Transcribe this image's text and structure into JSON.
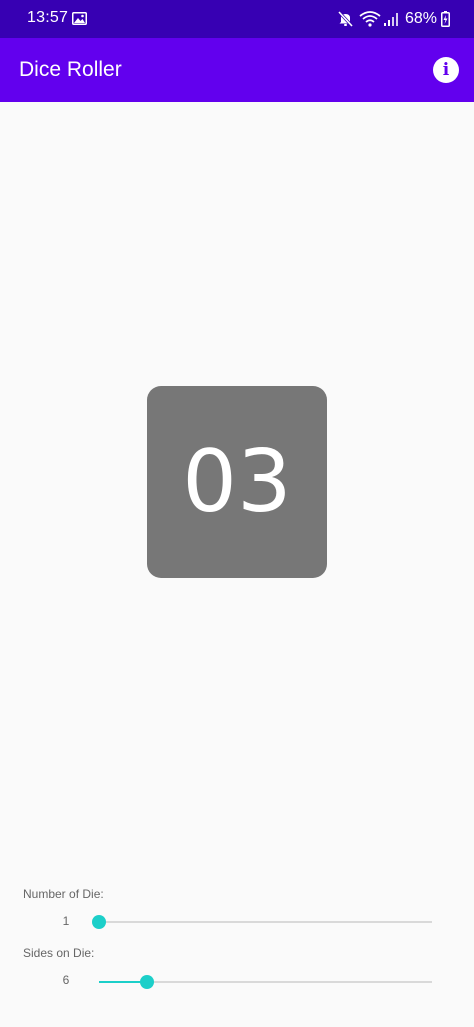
{
  "status_bar": {
    "time": "13:57",
    "battery": "68%",
    "icons": [
      "gallery-icon",
      "mute-icon",
      "wifi-icon",
      "signal-icon",
      "battery-icon"
    ]
  },
  "app_bar": {
    "title": "Dice Roller",
    "info_icon": "info-icon",
    "color": "#6200ee"
  },
  "die": {
    "value": "03",
    "color": "#777777"
  },
  "controls": {
    "number_of_die": {
      "label": "Number of Die:",
      "value": "1",
      "fraction": 0.0
    },
    "sides_on_die": {
      "label": "Sides on Die:",
      "value": "6",
      "fraction": 0.143
    },
    "accent": "#1ccfc9"
  }
}
